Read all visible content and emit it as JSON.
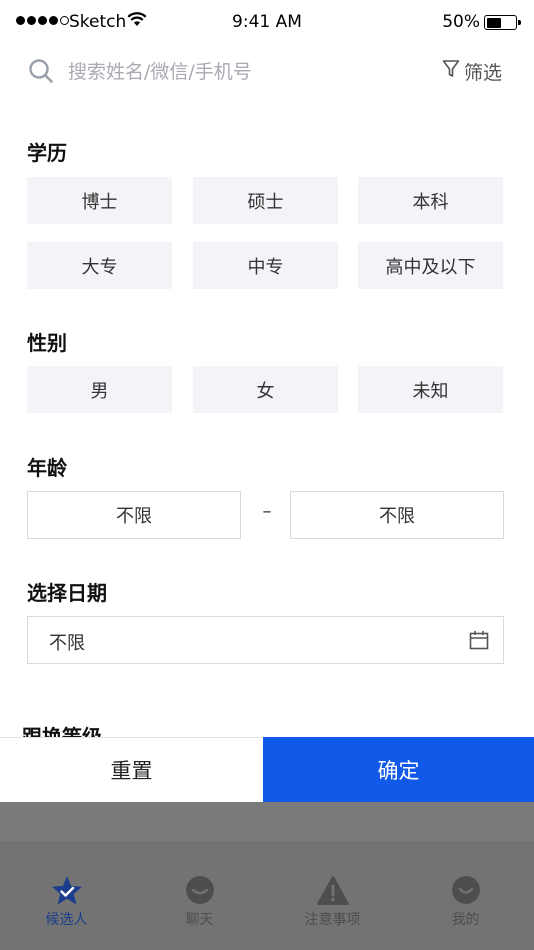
{
  "status_bar": {
    "carrier": "Sketch",
    "time": "9:41 AM",
    "battery": "50%"
  },
  "search": {
    "placeholder": "搜索姓名/微信/手机号",
    "filter_label": "筛选"
  },
  "education": {
    "title": "学历",
    "options": [
      "博士",
      "硕士",
      "本科",
      "大专",
      "中专",
      "高中及以下"
    ]
  },
  "gender": {
    "title": "性别",
    "options": [
      "男",
      "女",
      "未知"
    ]
  },
  "age": {
    "title": "年龄",
    "min": "不限",
    "separator": "–",
    "max": "不限"
  },
  "date": {
    "title": "选择日期",
    "value": "不限"
  },
  "next_section_title": "跟换等级",
  "actions": {
    "reset_label": "重置",
    "confirm_label": "确定"
  },
  "tabs": [
    {
      "label": "候选人",
      "icon": "star-check-icon",
      "active": true
    },
    {
      "label": "聊天",
      "icon": "chat-bubble-icon",
      "active": false
    },
    {
      "label": "注意事项",
      "icon": "warning-triangle-icon",
      "active": false
    },
    {
      "label": "我的",
      "icon": "smile-face-icon",
      "active": false
    }
  ],
  "colors": {
    "accent": "#1159e8",
    "chip_bg": "#f3f4f8",
    "tab_active": "#1a3d8c"
  }
}
